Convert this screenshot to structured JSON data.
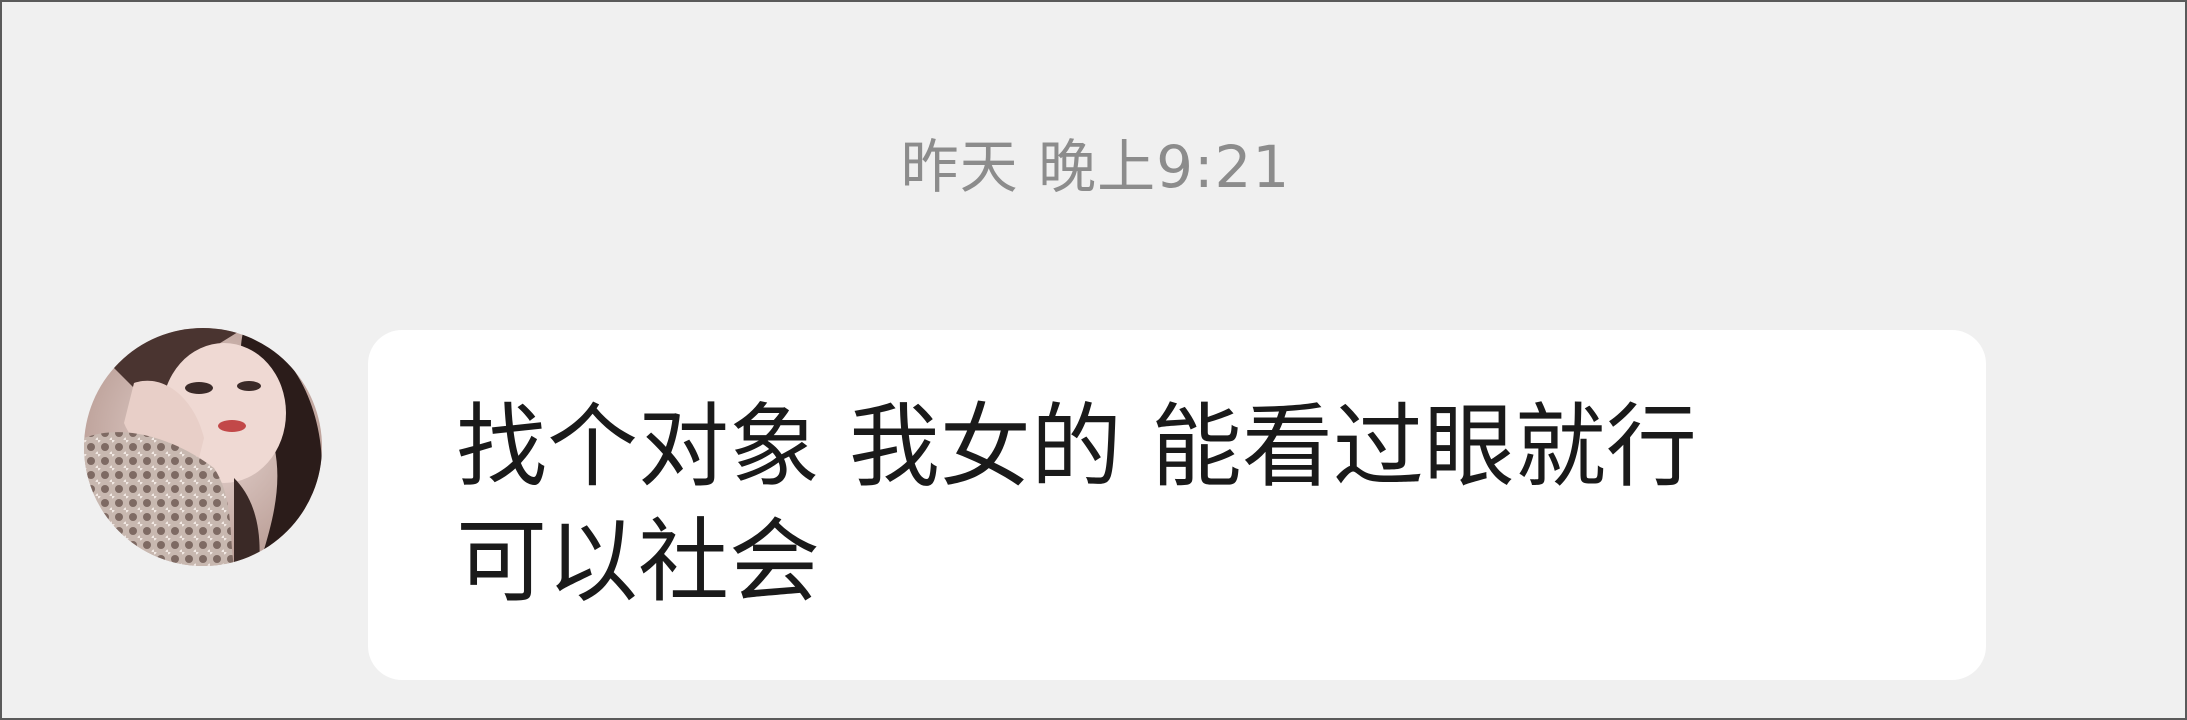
{
  "chat": {
    "timestamp": "昨天 晚上9:21",
    "messages": [
      {
        "sender_avatar_icon": "user-avatar-photo",
        "text": "找个对象 我女的 能看过眼就行\n可以社会"
      }
    ]
  }
}
